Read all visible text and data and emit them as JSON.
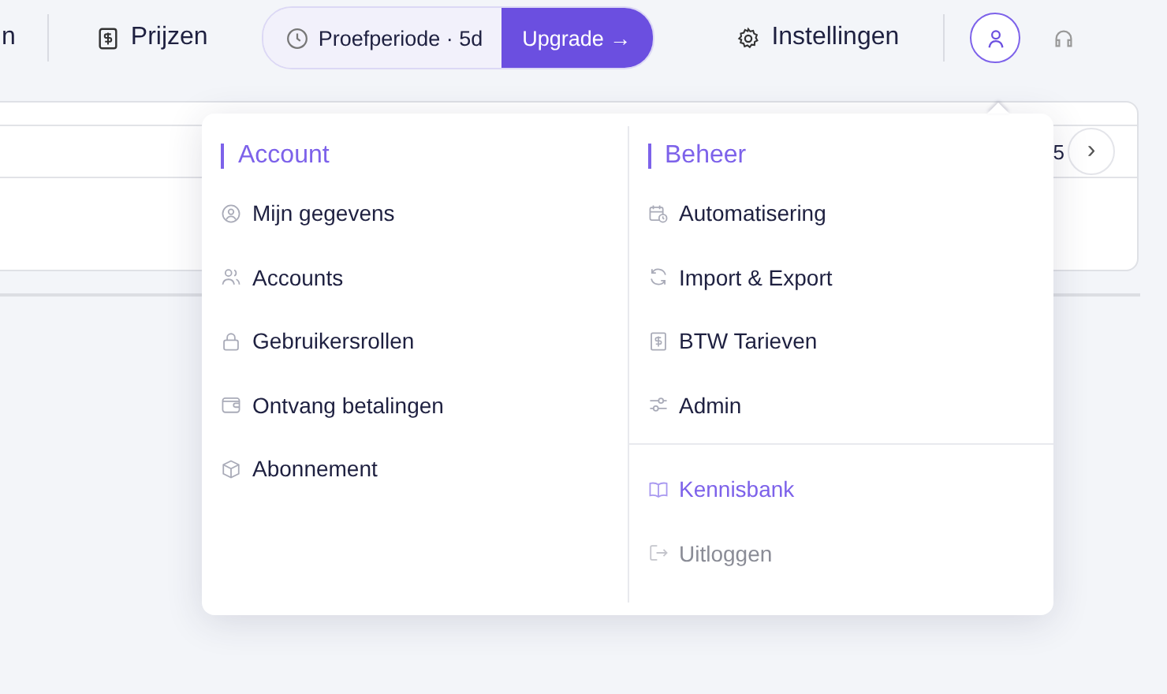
{
  "nav": {
    "cut_item": "n",
    "prices": "Prijzen",
    "trial": {
      "label": "Proefperiode · 5d",
      "upgrade": "Upgrade →"
    },
    "settings": "Instellingen"
  },
  "background_card": {
    "cut_text": "5",
    "next": "›"
  },
  "menu": {
    "columns": [
      {
        "title": "Account",
        "items": [
          {
            "label": "Mijn gegevens",
            "kind": "link"
          },
          {
            "label": "Accounts",
            "kind": "link"
          },
          {
            "label": "Gebruikersrollen",
            "kind": "link"
          },
          {
            "label": "Ontvang betalingen",
            "kind": "link"
          },
          {
            "label": "Abonnement",
            "kind": "link"
          }
        ]
      },
      {
        "title": "Beheer",
        "items": [
          {
            "label": "Automatisering",
            "kind": "link"
          },
          {
            "label": "Import & Export",
            "kind": "link"
          },
          {
            "label": "BTW Tarieven",
            "kind": "link"
          },
          {
            "label": "Admin",
            "kind": "link"
          }
        ],
        "footer": [
          {
            "label": "Kennisbank",
            "kind": "accent"
          },
          {
            "label": "Uitloggen",
            "kind": "muted"
          }
        ]
      }
    ]
  }
}
